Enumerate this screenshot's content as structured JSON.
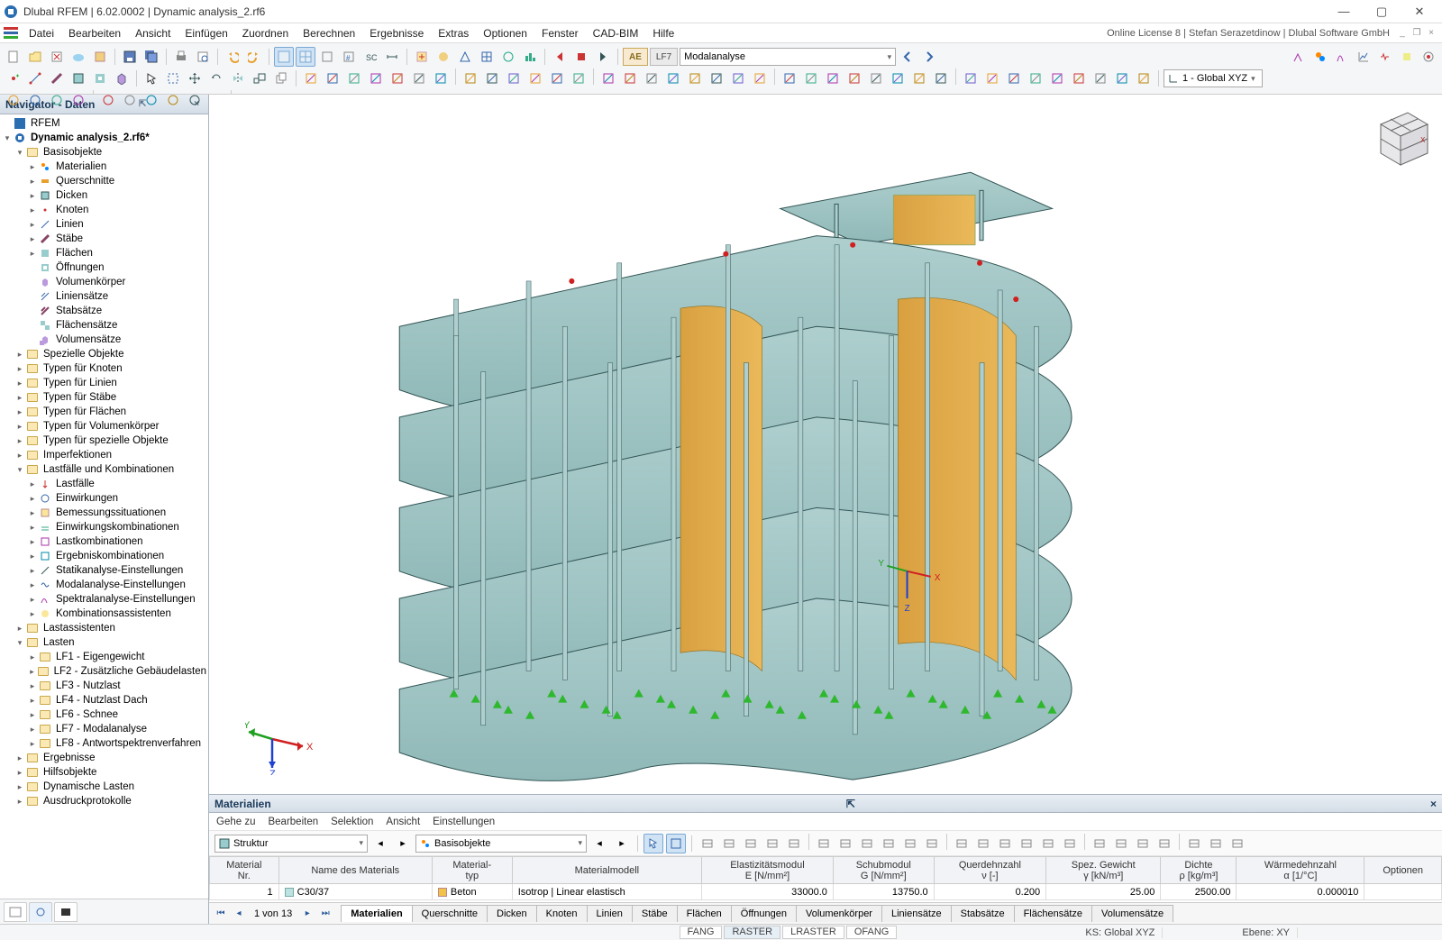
{
  "title": "Dlubal RFEM | 6.02.0002 | Dynamic analysis_2.rf6",
  "license": "Online License 8 | Stefan Serazetdinow | Dlubal Software GmbH",
  "menus": [
    "Datei",
    "Bearbeiten",
    "Ansicht",
    "Einfügen",
    "Zuordnen",
    "Berechnen",
    "Ergebnisse",
    "Extras",
    "Optionen",
    "Fenster",
    "CAD-BIM",
    "Hilfe"
  ],
  "toolbar": {
    "ae_badge": "AE",
    "lf_badge": "LF7",
    "lf_name": "Modalanalyse",
    "coord_sys": "1 - Global XYZ"
  },
  "navigator": {
    "title": "Navigator - Daten",
    "root": "RFEM",
    "model": "Dynamic analysis_2.rf6*",
    "basis": "Basisobjekte",
    "basis_items": [
      "Materialien",
      "Querschnitte",
      "Dicken",
      "Knoten",
      "Linien",
      "Stäbe",
      "Flächen",
      "Öffnungen",
      "Volumenkörper",
      "Liniensätze",
      "Stabsätze",
      "Flächensätze",
      "Volumensätze"
    ],
    "groups": [
      "Spezielle Objekte",
      "Typen für Knoten",
      "Typen für Linien",
      "Typen für Stäbe",
      "Typen für Flächen",
      "Typen für Volumenkörper",
      "Typen für spezielle Objekte",
      "Imperfektionen"
    ],
    "lfk": "Lastfälle und Kombinationen",
    "lfk_items": [
      "Lastfälle",
      "Einwirkungen",
      "Bemessungssituationen",
      "Einwirkungskombinationen",
      "Lastkombinationen",
      "Ergebniskombinationen",
      "Statikanalyse-Einstellungen",
      "Modalanalyse-Einstellungen",
      "Spektralanalyse-Einstellungen",
      "Kombinationsassistenten"
    ],
    "lastassistenten": "Lastassistenten",
    "lasten": "Lasten",
    "lasten_items": [
      "LF1 - Eigengewicht",
      "LF2 - Zusätzliche Gebäudelasten",
      "LF3 - Nutzlast",
      "LF4 - Nutzlast Dach",
      "LF6 - Schnee",
      "LF7 - Modalanalyse",
      "LF8 - Antwortspektrenverfahren"
    ],
    "tail": [
      "Ergebnisse",
      "Hilfsobjekte",
      "Dynamische Lasten",
      "Ausdruckprotokolle"
    ]
  },
  "bottom": {
    "title": "Materialien",
    "menus": [
      "Gehe zu",
      "Bearbeiten",
      "Selektion",
      "Ansicht",
      "Einstellungen"
    ],
    "combo1": "Struktur",
    "combo2": "Basisobjekte",
    "cols": [
      "Material\nNr.",
      "Name des Materials",
      "Material-\ntyp",
      "Materialmodell",
      "Elastizitätsmodul\nE [N/mm²]",
      "Schubmodul\nG [N/mm²]",
      "Querdehnzahl\nν [-]",
      "Spez. Gewicht\nγ [kN/m³]",
      "Dichte\nρ [kg/m³]",
      "Wärmedehnzahl\nα [1/°C]",
      "Optionen"
    ],
    "row": {
      "nr": "1",
      "name": "C30/37",
      "typ": "Beton",
      "modell": "Isotrop | Linear elastisch",
      "E": "33000.0",
      "G": "13750.0",
      "nu": "0.200",
      "gamma": "25.00",
      "rho": "2500.00",
      "alpha": "0.000010",
      "opt": ""
    },
    "nav": "1 von 13",
    "tabs": [
      "Materialien",
      "Querschnitte",
      "Dicken",
      "Knoten",
      "Linien",
      "Stäbe",
      "Flächen",
      "Öffnungen",
      "Volumenkörper",
      "Liniensätze",
      "Stabsätze",
      "Flächensätze",
      "Volumensätze"
    ]
  },
  "status": {
    "snap": [
      "FANG",
      "RASTER",
      "LRASTER",
      "OFANG"
    ],
    "ks": "KS: Global XYZ",
    "ebene": "Ebene: XY"
  },
  "axis": {
    "x": "X",
    "y": "Y",
    "z": "Z"
  }
}
